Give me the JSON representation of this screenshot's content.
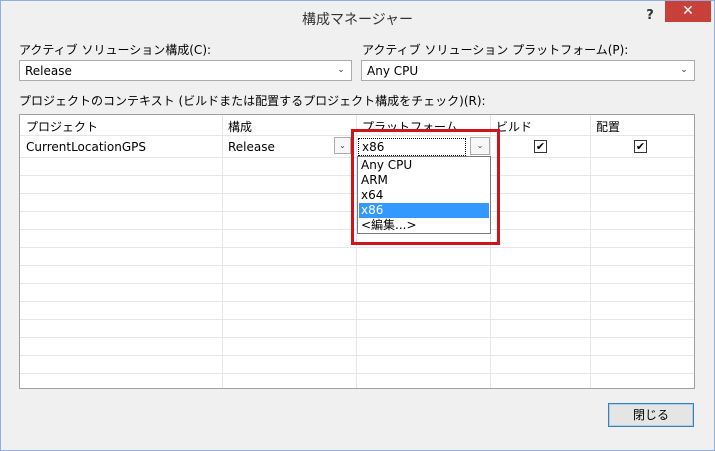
{
  "window": {
    "title": "構成マネージャー",
    "help": "?",
    "close": "✕"
  },
  "active_config": {
    "label": "アクティブ ソリューション構成(C):",
    "value": "Release"
  },
  "active_platform": {
    "label": "アクティブ ソリューション プラットフォーム(P):",
    "value": "Any CPU"
  },
  "context_label": "プロジェクトのコンテキスト (ビルドまたは配置するプロジェクト構成をチェック)(R):",
  "grid": {
    "columns": [
      "プロジェクト",
      "構成",
      "プラットフォーム",
      "ビルド",
      "配置"
    ],
    "rows": [
      {
        "project": "CurrentLocationGPS",
        "config": "Release",
        "platform": "x86",
        "build": true,
        "deploy": true
      }
    ]
  },
  "platform_dropdown": {
    "options": [
      "Any CPU",
      "ARM",
      "x64",
      "x86",
      "<編集...>"
    ],
    "selected": "x86"
  },
  "check_mark": "✔",
  "chevron": "⌄",
  "close_button": "閉じる"
}
